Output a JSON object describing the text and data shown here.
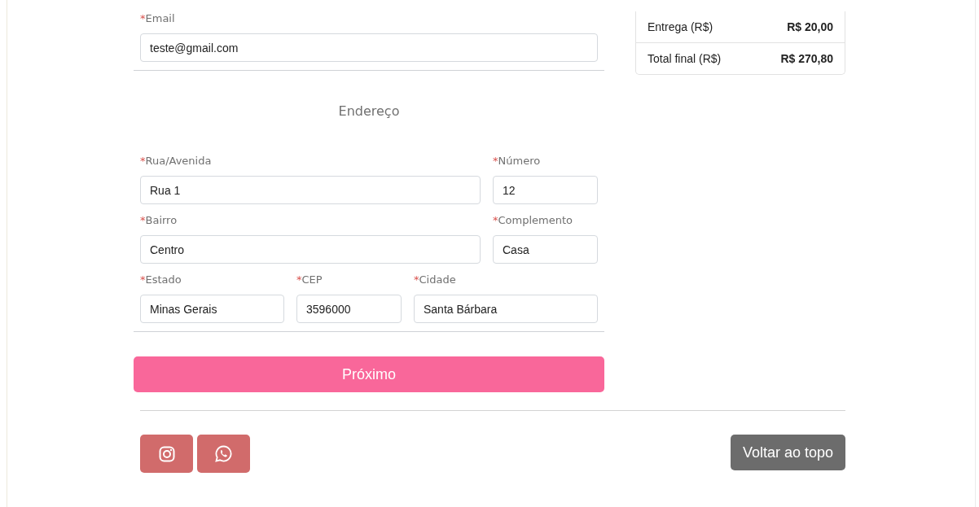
{
  "contact": {
    "fields": [
      {
        "label": "Email",
        "mark": "*",
        "value": "teste@gmail.com"
      }
    ]
  },
  "address": {
    "title": "Endereço",
    "rows": [
      [
        {
          "label": "Rua/Avenida",
          "mark": "*",
          "value": "Rua 1"
        },
        {
          "label": "Número",
          "mark": "*",
          "value": "12"
        }
      ],
      [
        {
          "label": "Bairro",
          "mark": "*",
          "value": "Centro"
        },
        {
          "label": "Complemento",
          "mark": "*",
          "value": "Casa"
        }
      ],
      [
        {
          "label": "Estado",
          "mark": "*",
          "value": "Minas Gerais"
        },
        {
          "label": "CEP",
          "mark": "*",
          "value": "3596000"
        },
        {
          "label": "Cidade",
          "mark": "*",
          "value": "Santa Bárbara"
        }
      ]
    ]
  },
  "next_button": "Próximo",
  "summary": {
    "rows": [
      {
        "label": "Entrega (R$)",
        "value": "R$ 20,00"
      },
      {
        "label": "Total final (R$)",
        "value": "R$ 270,80"
      }
    ]
  },
  "footer": {
    "social": [
      {
        "kind": "instagram"
      },
      {
        "kind": "whatsapp"
      }
    ],
    "back_to_top": "Voltar ao topo"
  }
}
